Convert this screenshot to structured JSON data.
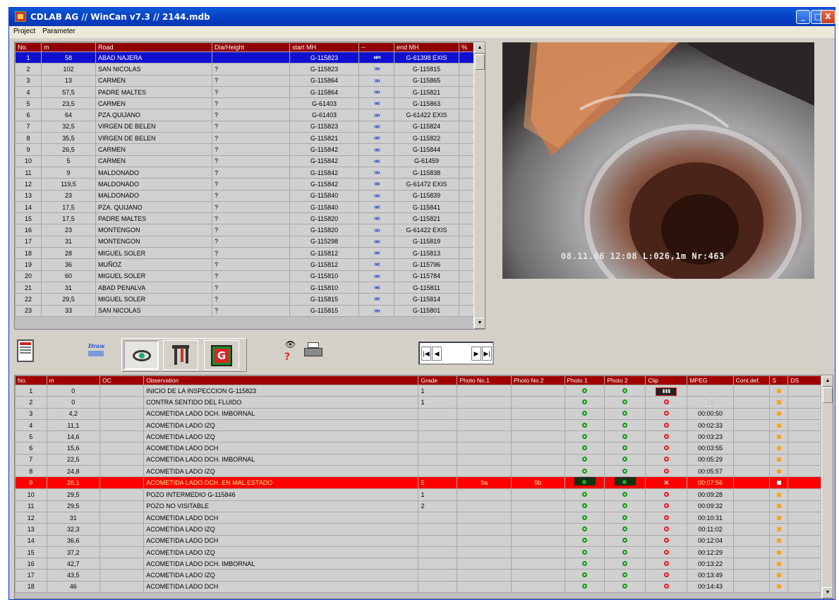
{
  "window": {
    "title": "CDLAB AG // WinCan v7.3  //  2144.mdb",
    "min_glyph": "_",
    "max_glyph": "□",
    "close_glyph": "X"
  },
  "menu": [
    "Project",
    "Parameter"
  ],
  "sections_table": {
    "headers": [
      "No.",
      "m",
      "Road",
      "Dia/Height",
      "start MH",
      "--",
      "end MH",
      "%"
    ],
    "rows": [
      [
        "1",
        "58",
        "ABAD NAJERA",
        "",
        "G-115823",
        "ccw",
        "G-61398 EXIS",
        ""
      ],
      [
        "2",
        "102",
        "SAN NICOLAS",
        "?",
        "G-115823",
        "fwd",
        "G-115815",
        ""
      ],
      [
        "3",
        "13",
        "CARMEN",
        "?",
        "G-115864",
        "fwd",
        "G-115865",
        ""
      ],
      [
        "4",
        "57,5",
        "PADRE MALTES",
        "?",
        "G-115864",
        "fwd",
        "G-115821",
        ""
      ],
      [
        "5",
        "23,5",
        "CARMEN",
        "?",
        "G-61403",
        "back",
        "G-115863",
        ""
      ],
      [
        "6",
        "64",
        "PZA.QUIJANO",
        "?",
        "G-61403",
        "fwd",
        "G-61422 EXIS",
        ""
      ],
      [
        "7",
        "32,5",
        "VIRGEN DE BELEN",
        "?",
        "G-115823",
        "back",
        "G-115824",
        ""
      ],
      [
        "8",
        "35,5",
        "VIRGEN DE BELEN",
        "?",
        "G-115821",
        "back",
        "G-115822",
        ""
      ],
      [
        "9",
        "26,5",
        "CARMEN",
        "?",
        "G-115842",
        "back",
        "G-115844",
        ""
      ],
      [
        "10",
        "5",
        "CARMEN",
        "?",
        "G-115842",
        "back",
        "G-61459",
        ""
      ],
      [
        "11",
        "9",
        "MALDONADO",
        "?",
        "G-115842",
        "fwd",
        "G-115838",
        ""
      ],
      [
        "12",
        "119,5",
        "MALDONADO",
        "?",
        "G-115842",
        "fwd",
        "G-61472 EXIS",
        ""
      ],
      [
        "13",
        "23",
        "MALDONADO",
        "?",
        "G-115840",
        "back",
        "G-115839",
        ""
      ],
      [
        "14",
        "17,5",
        "PZA. QUIJANO",
        "?",
        "G-115840",
        "back",
        "G-115841",
        ""
      ],
      [
        "15",
        "17,5",
        "PADRE MALTES",
        "?",
        "G-115820",
        "back",
        "G-115821",
        ""
      ],
      [
        "16",
        "23",
        "MONTENGON",
        "?",
        "G-115820",
        "fwd",
        "G-61422 EXIS",
        ""
      ],
      [
        "17",
        "31",
        "MONTENGON",
        "?",
        "G-115298",
        "back",
        "G-115819",
        ""
      ],
      [
        "18",
        "28",
        "MIGUEL SOLER",
        "?",
        "G-115812",
        "back",
        "G-115813",
        ""
      ],
      [
        "19",
        "36",
        "MUÑOZ",
        "?",
        "G-115812",
        "back",
        "G-115796",
        ""
      ],
      [
        "20",
        "60",
        "MIGUEL SOLER",
        "?",
        "G-115810",
        "back",
        "G-115784",
        ""
      ],
      [
        "21",
        "31",
        "ABAD PENALVA",
        "?",
        "G-115810",
        "back",
        "G-115811",
        ""
      ],
      [
        "22",
        "29,5",
        "MIGUEL SOLER",
        "?",
        "G-115815",
        "back",
        "G-115814",
        ""
      ],
      [
        "23",
        "33",
        "SAN NICOLAS",
        "?",
        "G-115815",
        "fwd",
        "G-115801",
        ""
      ]
    ],
    "selected_row": 0,
    "arrow_glyphs": {
      "fwd": "»»",
      "back": "««",
      "ccw": "«∞"
    }
  },
  "video": {
    "overlay": "08.11.06  12:08  L:026,1m  Nr:463"
  },
  "toolbar": {
    "draw_label": "Draw",
    "icons": [
      "report-icon",
      "draw-icon",
      "eye-icon",
      "tools-icon",
      "graph-icon",
      "binoculars-icon",
      "help-icon",
      "printer-icon"
    ],
    "nav": {
      "first": "|◀",
      "prev": "◀",
      "next": "▶",
      "last": "▶|"
    }
  },
  "observations_table": {
    "headers": [
      "No.",
      "m",
      "OC",
      "Observation",
      "Grade",
      "Photo No.1",
      "Photo No.2",
      "Photo 1",
      "Photo 2",
      "Clip",
      "MPEG",
      "Cont.def.",
      "S",
      "DS"
    ],
    "rows": [
      [
        "1",
        "0",
        "",
        "INICIO DE LA INSPECCION G-115823",
        "1",
        "",
        "",
        "g",
        "g",
        "clip",
        ": :",
        "",
        "o",
        ""
      ],
      [
        "2",
        "0",
        "",
        "CONTRA SENTIDO DEL FLUIDO",
        "1",
        "",
        "",
        "g",
        "g",
        "r",
        ": :",
        "",
        "o",
        ""
      ],
      [
        "3",
        "4,2",
        "",
        "ACOMETIDA LADO DCH. IMBORNAL",
        "",
        "",
        "",
        "g",
        "g",
        "r",
        "00:00:50",
        "",
        "o",
        ""
      ],
      [
        "4",
        "11,1",
        "",
        "ACOMETIDA LADO IZQ",
        "",
        "",
        "",
        "g",
        "g",
        "r",
        "00:02:33",
        "",
        "o",
        ""
      ],
      [
        "5",
        "14,6",
        "",
        "ACOMETIDA LADO IZQ",
        "",
        "",
        "",
        "g",
        "g",
        "r",
        "00:03:23",
        "",
        "o",
        ""
      ],
      [
        "6",
        "15,6",
        "",
        "ACOMETIDA LADO DCH",
        "",
        "",
        "",
        "g",
        "g",
        "r",
        "00:03:55",
        "",
        "o",
        ""
      ],
      [
        "7",
        "22,5",
        "",
        "ACOMETIDA LADO DCH. IMBORNAL",
        "",
        "",
        "",
        "g",
        "g",
        "r",
        "00:05:29",
        "",
        "o",
        ""
      ],
      [
        "8",
        "24,8",
        "",
        "ACOMETIDA LADO IZQ",
        "",
        "",
        "",
        "g",
        "g",
        "r",
        "00:05:57",
        "",
        "o",
        ""
      ],
      [
        "9",
        "26,1",
        "",
        "ACOMETIDA LADO DCH. EN MAL ESTADO",
        "5",
        "9a",
        "9b",
        "cam",
        "cam",
        "x",
        "00:07:56",
        "",
        "o",
        ""
      ],
      [
        "10",
        "29,5",
        "",
        "POZO INTERMEDIO G-115846",
        "1",
        "",
        "",
        "g",
        "g",
        "r",
        "00:09:28",
        "",
        "o",
        ""
      ],
      [
        "11",
        "29,5",
        "",
        "POZO NO VISITABLE",
        "2",
        "",
        "",
        "g",
        "g",
        "r",
        "00:09:32",
        "",
        "o",
        ""
      ],
      [
        "12",
        "31",
        "",
        "ACOMETIDA LADO DCH",
        "",
        "",
        "",
        "g",
        "g",
        "r",
        "00:10:31",
        "",
        "o",
        ""
      ],
      [
        "13",
        "32,3",
        "",
        "ACOMETIDA LADO IZQ",
        "",
        "",
        "",
        "g",
        "g",
        "r",
        "00:11:02",
        "",
        "o",
        ""
      ],
      [
        "14",
        "36,6",
        "",
        "ACOMETIDA LADO DCH",
        "",
        "",
        "",
        "g",
        "g",
        "r",
        "00:12:04",
        "",
        "o",
        ""
      ],
      [
        "15",
        "37,2",
        "",
        "ACOMETIDA LADO IZQ",
        "",
        "",
        "",
        "g",
        "g",
        "r",
        "00:12:29",
        "",
        "o",
        ""
      ],
      [
        "16",
        "42,7",
        "",
        "ACOMETIDA LADO DCH. IMBORNAL",
        "",
        "",
        "",
        "g",
        "g",
        "r",
        "00:13:22",
        "",
        "o",
        ""
      ],
      [
        "17",
        "43,5",
        "",
        "ACOMETIDA LADO IZQ",
        "",
        "",
        "",
        "g",
        "g",
        "r",
        "00:13:49",
        "",
        "o",
        ""
      ],
      [
        "18",
        "46",
        "",
        "ACOMETIDA LADO DCH",
        "",
        "",
        "",
        "g",
        "g",
        "r",
        "00:14:43",
        "",
        "o",
        ""
      ]
    ],
    "alert_row": 8
  },
  "colors": {
    "header_bg": "#900000",
    "selected_row": "#1010d0",
    "alert_row": "#ff0000",
    "ok_dot": "#0a9a0a",
    "clip_dot": "#e21c1c",
    "status_square": "#f5a623"
  }
}
